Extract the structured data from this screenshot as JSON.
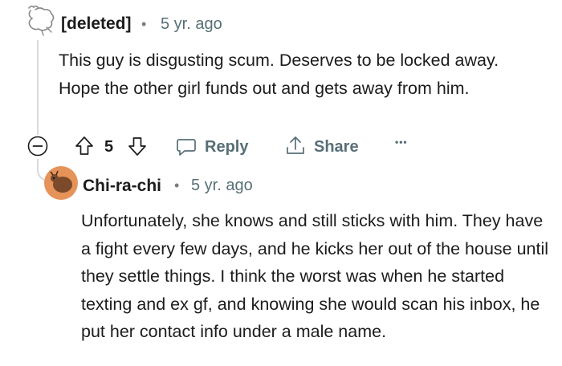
{
  "comment1": {
    "author": "[deleted]",
    "separator": "•",
    "time": "5 yr. ago",
    "body": "This guy is disgusting scum. Deserves to be locked away. Hope the other girl funds out and gets away from him."
  },
  "actions": {
    "vote_count": "5",
    "reply_label": "Reply",
    "share_label": "Share",
    "more_label": "•••"
  },
  "comment2": {
    "author": "Chi-ra-chi",
    "separator": "•",
    "time": "5 yr. ago",
    "body": "Unfortunately, she knows and still sticks with him. They have a fight every few days, and he kicks her out of the house until they settle things. I think the worst was when he started texting and ex gf, and knowing she would scan his inbox, he put her contact info under a male name."
  },
  "colors": {
    "text": "#1c1c1c",
    "meta": "#576f76",
    "thread_line": "#d7dadc",
    "avatar": "#e6935a"
  },
  "icons": [
    "deleted-avatar-icon",
    "collapse-icon",
    "upvote-icon",
    "downvote-icon",
    "reply-icon",
    "share-icon",
    "more-icon",
    "user-avatar-icon"
  ]
}
